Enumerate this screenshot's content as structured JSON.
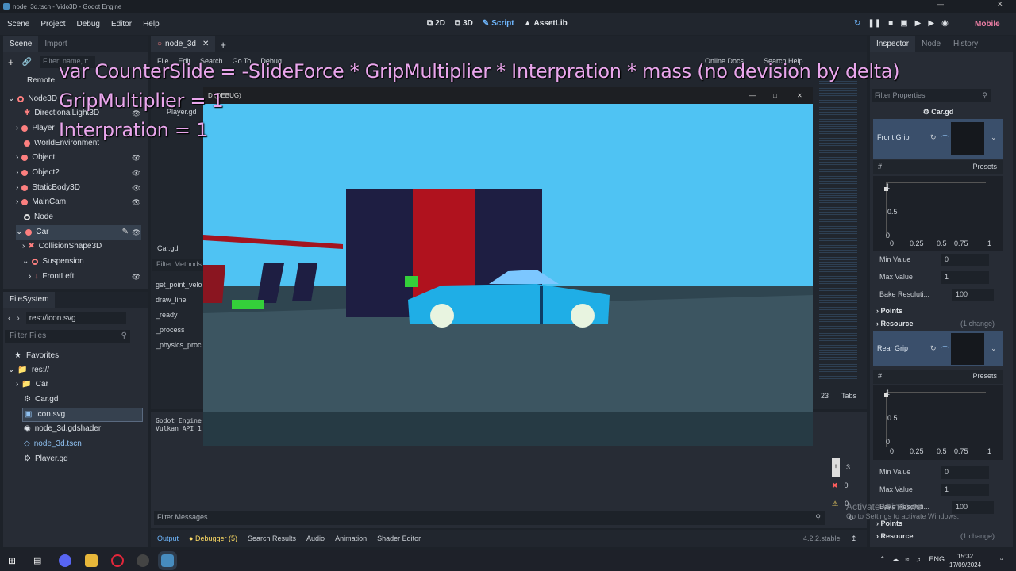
{
  "window": {
    "title": "node_3d.tscn - Vido3D - Godot Engine"
  },
  "menu": [
    "Scene",
    "Project",
    "Debug",
    "Editor",
    "Help"
  ],
  "workspaces": [
    {
      "label": "2D",
      "active": false
    },
    {
      "label": "3D",
      "active": false
    },
    {
      "label": "Script",
      "active": true
    },
    {
      "label": "AssetLib",
      "active": false
    }
  ],
  "renderer": "Mobile",
  "scene_dock": {
    "tabs": [
      "Scene",
      "Import"
    ],
    "filter_placeholder": "Filter: name, t:",
    "remote_label": "Remote",
    "nodes": [
      {
        "label": "Node3D",
        "color": "#fc7f7f",
        "depth": 0
      },
      {
        "label": "DirectionalLight3D",
        "color": "#fc7f7f",
        "depth": 1
      },
      {
        "label": "Player",
        "color": "#fc7f7f",
        "depth": 1
      },
      {
        "label": "WorldEnvironment",
        "color": "#fc7f7f",
        "depth": 1
      },
      {
        "label": "Object",
        "color": "#fc7f7f",
        "depth": 1
      },
      {
        "label": "Object2",
        "color": "#fc7f7f",
        "depth": 1
      },
      {
        "label": "StaticBody3D",
        "color": "#fc7f7f",
        "depth": 1
      },
      {
        "label": "MainCam",
        "color": "#fc7f7f",
        "depth": 1
      },
      {
        "label": "Node",
        "color": "#e0e0e0",
        "depth": 1
      },
      {
        "label": "Car",
        "color": "#fc7f7f",
        "depth": 1,
        "selected": true
      },
      {
        "label": "CollisionShape3D",
        "color": "#fc7f7f",
        "depth": 2
      },
      {
        "label": "Suspension",
        "color": "#fc7f7f",
        "depth": 2
      },
      {
        "label": "FrontLeft",
        "color": "#fc7f7f",
        "depth": 3
      }
    ]
  },
  "filesystem": {
    "title": "FileSystem",
    "path": "res://icon.svg",
    "filter_placeholder": "Filter Files",
    "favorites_label": "Favorites:",
    "items": [
      {
        "label": "res://",
        "depth": 0
      },
      {
        "label": "Car",
        "depth": 1
      },
      {
        "label": "Car.gd",
        "depth": 1
      },
      {
        "label": "icon.svg",
        "depth": 1,
        "selected": true
      },
      {
        "label": "node_3d.gdshader",
        "depth": 1
      },
      {
        "label": "node_3d.tscn",
        "depth": 1,
        "highlight": true
      },
      {
        "label": "Player.gd",
        "depth": 1
      }
    ]
  },
  "script_editor": {
    "scene_tab": "node_3d",
    "menu": [
      "File",
      "Edit",
      "Search",
      "Go To",
      "Debug"
    ],
    "online_docs": "Online Docs",
    "search_help": "Search Help",
    "script_list_item": "Player.gd",
    "current_script": "Car.gd",
    "filter_methods_placeholder": "Filter Methods",
    "methods": [
      "get_point_velo",
      "draw_line",
      "_ready",
      "_process",
      "_physics_proc"
    ],
    "line_col": "23",
    "tabs_label": "Tabs"
  },
  "output": {
    "lines": [
      "Godot Engine",
      "Vulkan API 1"
    ],
    "filter_placeholder": "Filter Messages",
    "counts": {
      "messages": "3",
      "errors": "0",
      "warnings": "0",
      "other": "0"
    }
  },
  "bottom_tabs": [
    "Output",
    "Debugger (5)",
    "Search Results",
    "Audio",
    "Animation",
    "Shader Editor"
  ],
  "version": "4.2.2.stable",
  "game_window": {
    "title": "D (DEBUG)"
  },
  "overlay_text": [
    "var CounterSlide = -SlideForce * GripMultiplier * Interpration * mass (no devision by delta)",
    "GripMultiplier = 1",
    "Interpration = 1"
  ],
  "inspector": {
    "tabs": [
      "Inspector",
      "Node",
      "History"
    ],
    "filter_placeholder": "Filter Properties",
    "resource_name": "Car.gd",
    "sections": [
      {
        "label": "Front Grip",
        "presets": "Presets",
        "y_ticks": [
          "1",
          "0.5",
          "0"
        ],
        "x_ticks": [
          "0",
          "0.25",
          "0.5",
          "0.75",
          "1"
        ],
        "min_label": "Min Value",
        "min_value": "0",
        "max_label": "Max Value",
        "max_value": "1",
        "bake_label": "Bake Resoluti...",
        "bake_value": "100",
        "points_label": "Points",
        "resource_label": "Resource",
        "change_label": "(1 change)"
      },
      {
        "label": "Rear Grip",
        "presets": "Presets",
        "y_ticks": [
          "1",
          "0.5",
          "0"
        ],
        "x_ticks": [
          "0",
          "0.25",
          "0.5",
          "0.75",
          "1"
        ],
        "min_label": "Min Value",
        "min_value": "0",
        "max_label": "Max Value",
        "max_value": "1",
        "bake_label": "Bake Resoluti...",
        "bake_value": "100",
        "points_label": "Points",
        "resource_label": "Resource",
        "change_label": "(1 change)"
      }
    ]
  },
  "watermark": {
    "line1": "Activate Windows",
    "line2": "Go to Settings to activate Windows."
  },
  "taskbar": {
    "lang": "ENG",
    "time": "15:32",
    "date": "17/09/2024"
  }
}
